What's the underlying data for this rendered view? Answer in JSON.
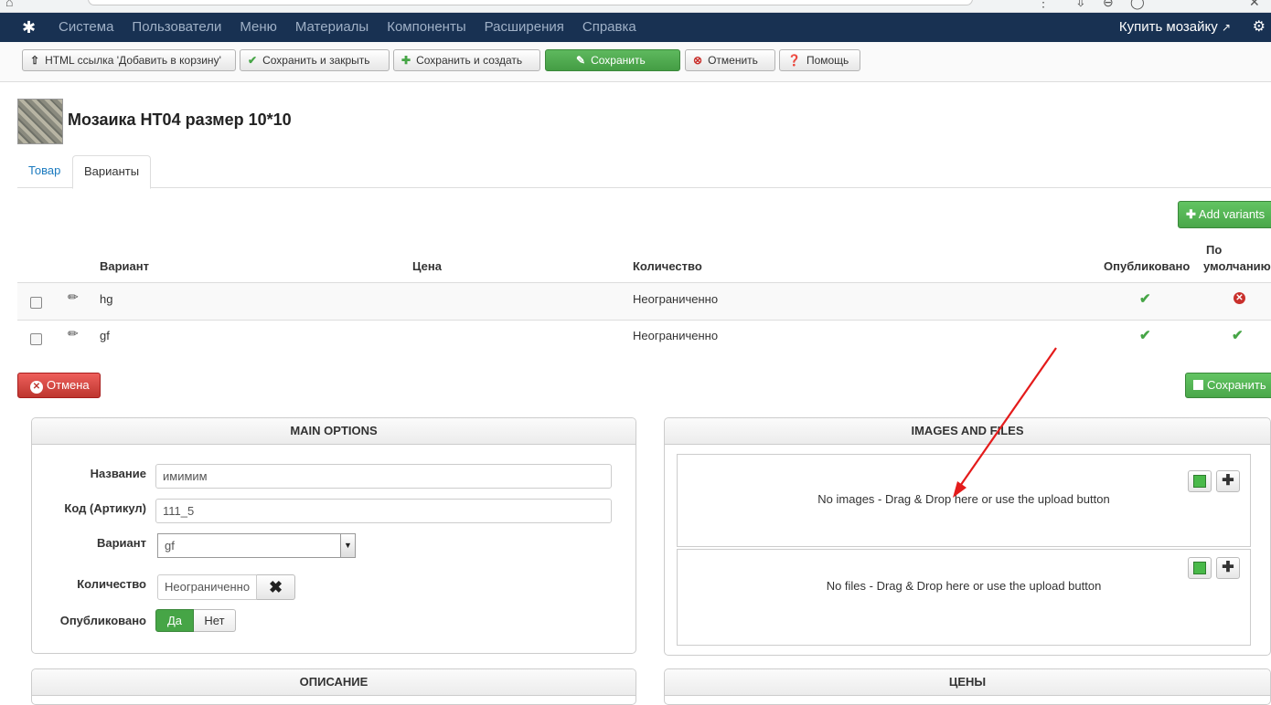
{
  "browser": {
    "glyphs": [
      "⌂",
      "⋮",
      "⇩",
      "⊖",
      "◯",
      "✕"
    ]
  },
  "topnav": {
    "logo": "✱",
    "menu": [
      "Система",
      "Пользователи",
      "Меню",
      "Материалы",
      "Компоненты",
      "Расширения",
      "Справка"
    ],
    "buy": "Купить мозайку",
    "buy_icon": "↗",
    "gear_icon": "⚙"
  },
  "toolbar": {
    "html_link": "HTML ссылка 'Добавить в корзину'",
    "save_close": "Сохранить и закрыть",
    "save_new": "Сохранить и создать",
    "save": "Сохранить",
    "cancel": "Отменить",
    "help": "Помощь"
  },
  "product": {
    "title": "Мозаика HT04 размер 10*10"
  },
  "tabs": [
    "Товар",
    "Варианты"
  ],
  "variants": {
    "add_button": "Add variants",
    "columns": [
      "Вариант",
      "Цена",
      "Количество",
      "Опубликовано",
      "По",
      "умолчанию"
    ],
    "rows": [
      {
        "name": "hg",
        "price": "",
        "quantity": "Неограниченно",
        "published": true,
        "default": false
      },
      {
        "name": "gf",
        "price": "",
        "quantity": "Неограниченно",
        "published": true,
        "default": true
      }
    ],
    "cancel": "Отмена",
    "save": "Сохранить"
  },
  "main_options": {
    "heading": "MAIN OPTIONS",
    "name_label": "Название",
    "name_value": "имимим",
    "sku_label": "Код (Артикул)",
    "sku_value": "111_5",
    "variant_label": "Вариант",
    "variant_value": "gf",
    "qty_label": "Количество",
    "qty_value": "Неограниченно",
    "published_label": "Опубликовано",
    "yes": "Да",
    "no": "Нет",
    "published": true
  },
  "images_files": {
    "heading": "IMAGES AND FILES",
    "no_images": "No images - Drag & Drop here or use the upload button",
    "no_files": "No files - Drag & Drop here or use the upload button"
  },
  "bottom_panels": [
    "ОПИСАНИЕ",
    "ЦЕНЫ"
  ],
  "colors": {
    "nav": "#183152",
    "green": "#46a546",
    "red": "#c9302c",
    "link": "#1a7abf"
  }
}
